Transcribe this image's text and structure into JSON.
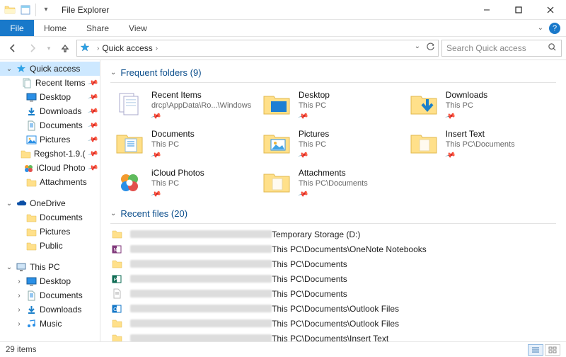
{
  "window": {
    "title": "File Explorer"
  },
  "ribbon": {
    "file": "File",
    "tabs": [
      "Home",
      "Share",
      "View"
    ]
  },
  "address": {
    "location": "Quick access",
    "search_placeholder": "Search Quick access"
  },
  "sidebar": {
    "quick_access": {
      "label": "Quick access",
      "items": [
        {
          "label": "Recent Items",
          "icon": "recent",
          "pinned": true
        },
        {
          "label": "Desktop",
          "icon": "desktop",
          "pinned": true
        },
        {
          "label": "Downloads",
          "icon": "downloads",
          "pinned": true
        },
        {
          "label": "Documents",
          "icon": "documents",
          "pinned": true
        },
        {
          "label": "Pictures",
          "icon": "pictures",
          "pinned": true
        },
        {
          "label": "Regshot-1.9.(",
          "icon": "folder",
          "pinned": true
        },
        {
          "label": "iCloud Photo",
          "icon": "icloud",
          "pinned": true
        },
        {
          "label": "Attachments",
          "icon": "folder",
          "pinned": false
        }
      ]
    },
    "onedrive": {
      "label": "OneDrive",
      "items": [
        {
          "label": "Documents",
          "icon": "folder"
        },
        {
          "label": "Pictures",
          "icon": "folder"
        },
        {
          "label": "Public",
          "icon": "folder"
        }
      ]
    },
    "thispc": {
      "label": "This PC",
      "items": [
        {
          "label": "Desktop",
          "icon": "desktop"
        },
        {
          "label": "Documents",
          "icon": "documents"
        },
        {
          "label": "Downloads",
          "icon": "downloads"
        },
        {
          "label": "Music",
          "icon": "music"
        }
      ]
    }
  },
  "sections": {
    "frequent": {
      "title": "Frequent folders (9)",
      "items": [
        {
          "name": "Recent Items",
          "sub": "drcp\\AppData\\Ro...\\Windows",
          "icon": "recent"
        },
        {
          "name": "Desktop",
          "sub": "This PC",
          "icon": "desktop"
        },
        {
          "name": "Downloads",
          "sub": "This PC",
          "icon": "downloads"
        },
        {
          "name": "Documents",
          "sub": "This PC",
          "icon": "documents"
        },
        {
          "name": "Pictures",
          "sub": "This PC",
          "icon": "pictures"
        },
        {
          "name": "Insert Text",
          "sub": "This PC\\Documents",
          "icon": "folder"
        },
        {
          "name": "iCloud Photos",
          "sub": "This PC",
          "icon": "icloud"
        },
        {
          "name": "Attachments",
          "sub": "This PC\\Documents",
          "icon": "folder"
        }
      ]
    },
    "recent": {
      "title": "Recent files (20)",
      "items": [
        {
          "icon": "generic",
          "location": "Temporary Storage (D:)"
        },
        {
          "icon": "onenote",
          "location": "This PC\\Documents\\OneNote Notebooks"
        },
        {
          "icon": "generic",
          "location": "This PC\\Documents"
        },
        {
          "icon": "publisher",
          "location": "This PC\\Documents"
        },
        {
          "icon": "text",
          "location": "This PC\\Documents"
        },
        {
          "icon": "outlook",
          "location": "This PC\\Documents\\Outlook Files"
        },
        {
          "icon": "generic",
          "location": "This PC\\Documents\\Outlook Files"
        },
        {
          "icon": "generic",
          "location": "This PC\\Documents\\Insert Text"
        }
      ]
    }
  },
  "statusbar": {
    "count": "29 items"
  }
}
